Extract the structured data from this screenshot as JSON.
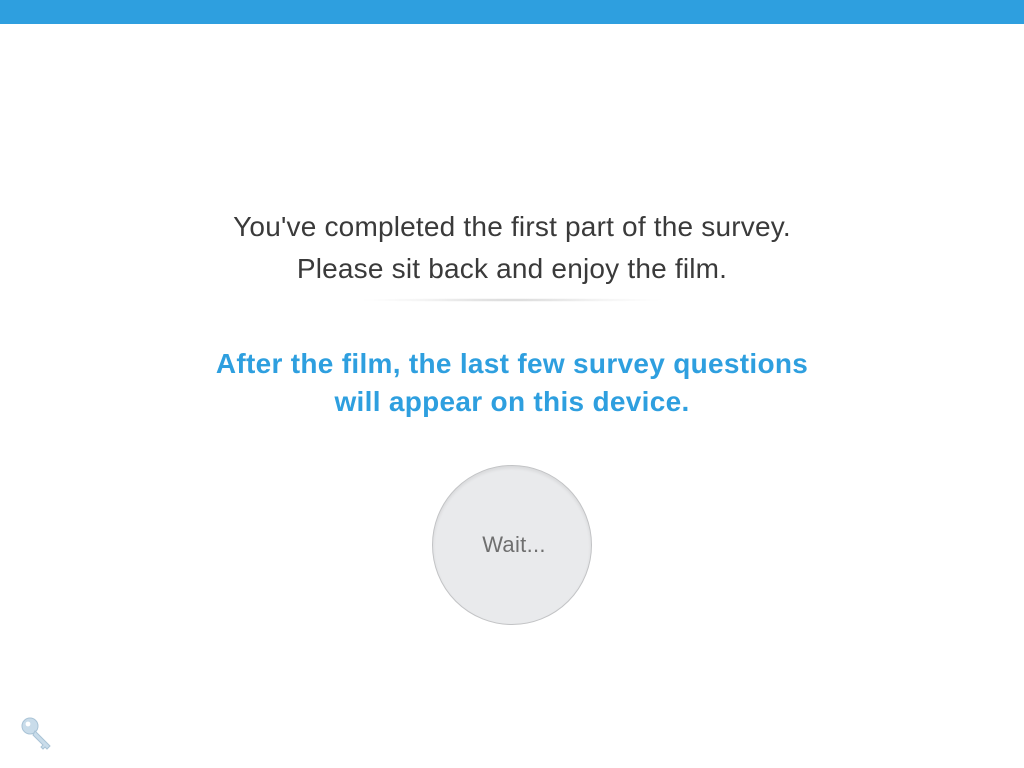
{
  "header": {
    "bar_color": "#2e9fdf"
  },
  "message": {
    "line1": "You've completed the first part of the survey.",
    "line2": "Please sit back and enjoy the film."
  },
  "notice": {
    "line1": "After the film, the last few survey questions",
    "line2": "will appear on this device.",
    "color": "#2e9fdf"
  },
  "wait_button": {
    "label": "Wait..."
  },
  "icons": {
    "key": "key-icon"
  }
}
